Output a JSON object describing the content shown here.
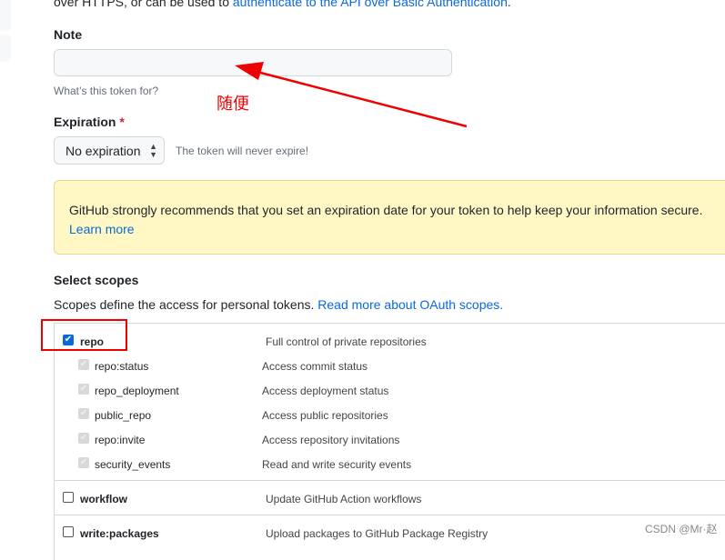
{
  "intro": {
    "text": "over HTTPS, or can be used to ",
    "link": "authenticate to the API over Basic Authentication",
    "end": "."
  },
  "note": {
    "label": "Note",
    "value": "",
    "help": "What’s this token for?"
  },
  "annotation": "随便",
  "expiration": {
    "label": "Expiration",
    "required": "*",
    "selected": "No expiration",
    "hint": "The token will never expire!"
  },
  "flash": {
    "text": "GitHub strongly recommends that you set an expiration date for your token to help keep your information secure.",
    "link": "Learn more"
  },
  "scopes": {
    "title": "Select scopes",
    "desc": "Scopes define the access for personal tokens. ",
    "link": "Read more about OAuth scopes.",
    "items": [
      {
        "name": "repo",
        "desc": "Full control of private repositories",
        "checked": true,
        "children": [
          {
            "name": "repo:status",
            "desc": "Access commit status"
          },
          {
            "name": "repo_deployment",
            "desc": "Access deployment status"
          },
          {
            "name": "public_repo",
            "desc": "Access public repositories"
          },
          {
            "name": "repo:invite",
            "desc": "Access repository invitations"
          },
          {
            "name": "security_events",
            "desc": "Read and write security events"
          }
        ]
      },
      {
        "name": "workflow",
        "desc": "Update GitHub Action workflows",
        "checked": false
      },
      {
        "name": "write:packages",
        "desc": "Upload packages to GitHub Package Registry",
        "checked": false
      }
    ]
  },
  "watermark": "CSDN @Mr·赵",
  "colors": {
    "accent": "#0969da",
    "annotation": "#e00000",
    "flash_bg": "#fff8c5"
  }
}
